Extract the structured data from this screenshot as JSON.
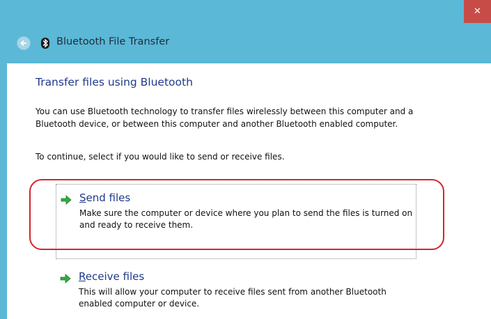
{
  "window": {
    "title": "Bluetooth File Transfer",
    "close_label": "✕",
    "accent_color": "#5bb8d7",
    "close_color": "#c74c48"
  },
  "page": {
    "heading": "Transfer files using Bluetooth",
    "description": "You can use Bluetooth technology to transfer files wirelessly between this computer and a Bluetooth device, or between this computer and another Bluetooth enabled computer.",
    "instruction": "To continue, select if you would like to send or receive files."
  },
  "options": [
    {
      "title_first": "S",
      "title_rest": "end files",
      "description": "Make sure the computer or device where you plan to send the files is turned on and ready to receive them.",
      "icon": "green-arrow-icon",
      "highlighted": true
    },
    {
      "title_first": "R",
      "title_rest": "eceive files",
      "description": "This will allow your computer to receive files sent from another Bluetooth enabled computer or device.",
      "icon": "green-arrow-icon",
      "highlighted": false
    }
  ],
  "annotation": {
    "highlight_color": "#d3262a"
  }
}
